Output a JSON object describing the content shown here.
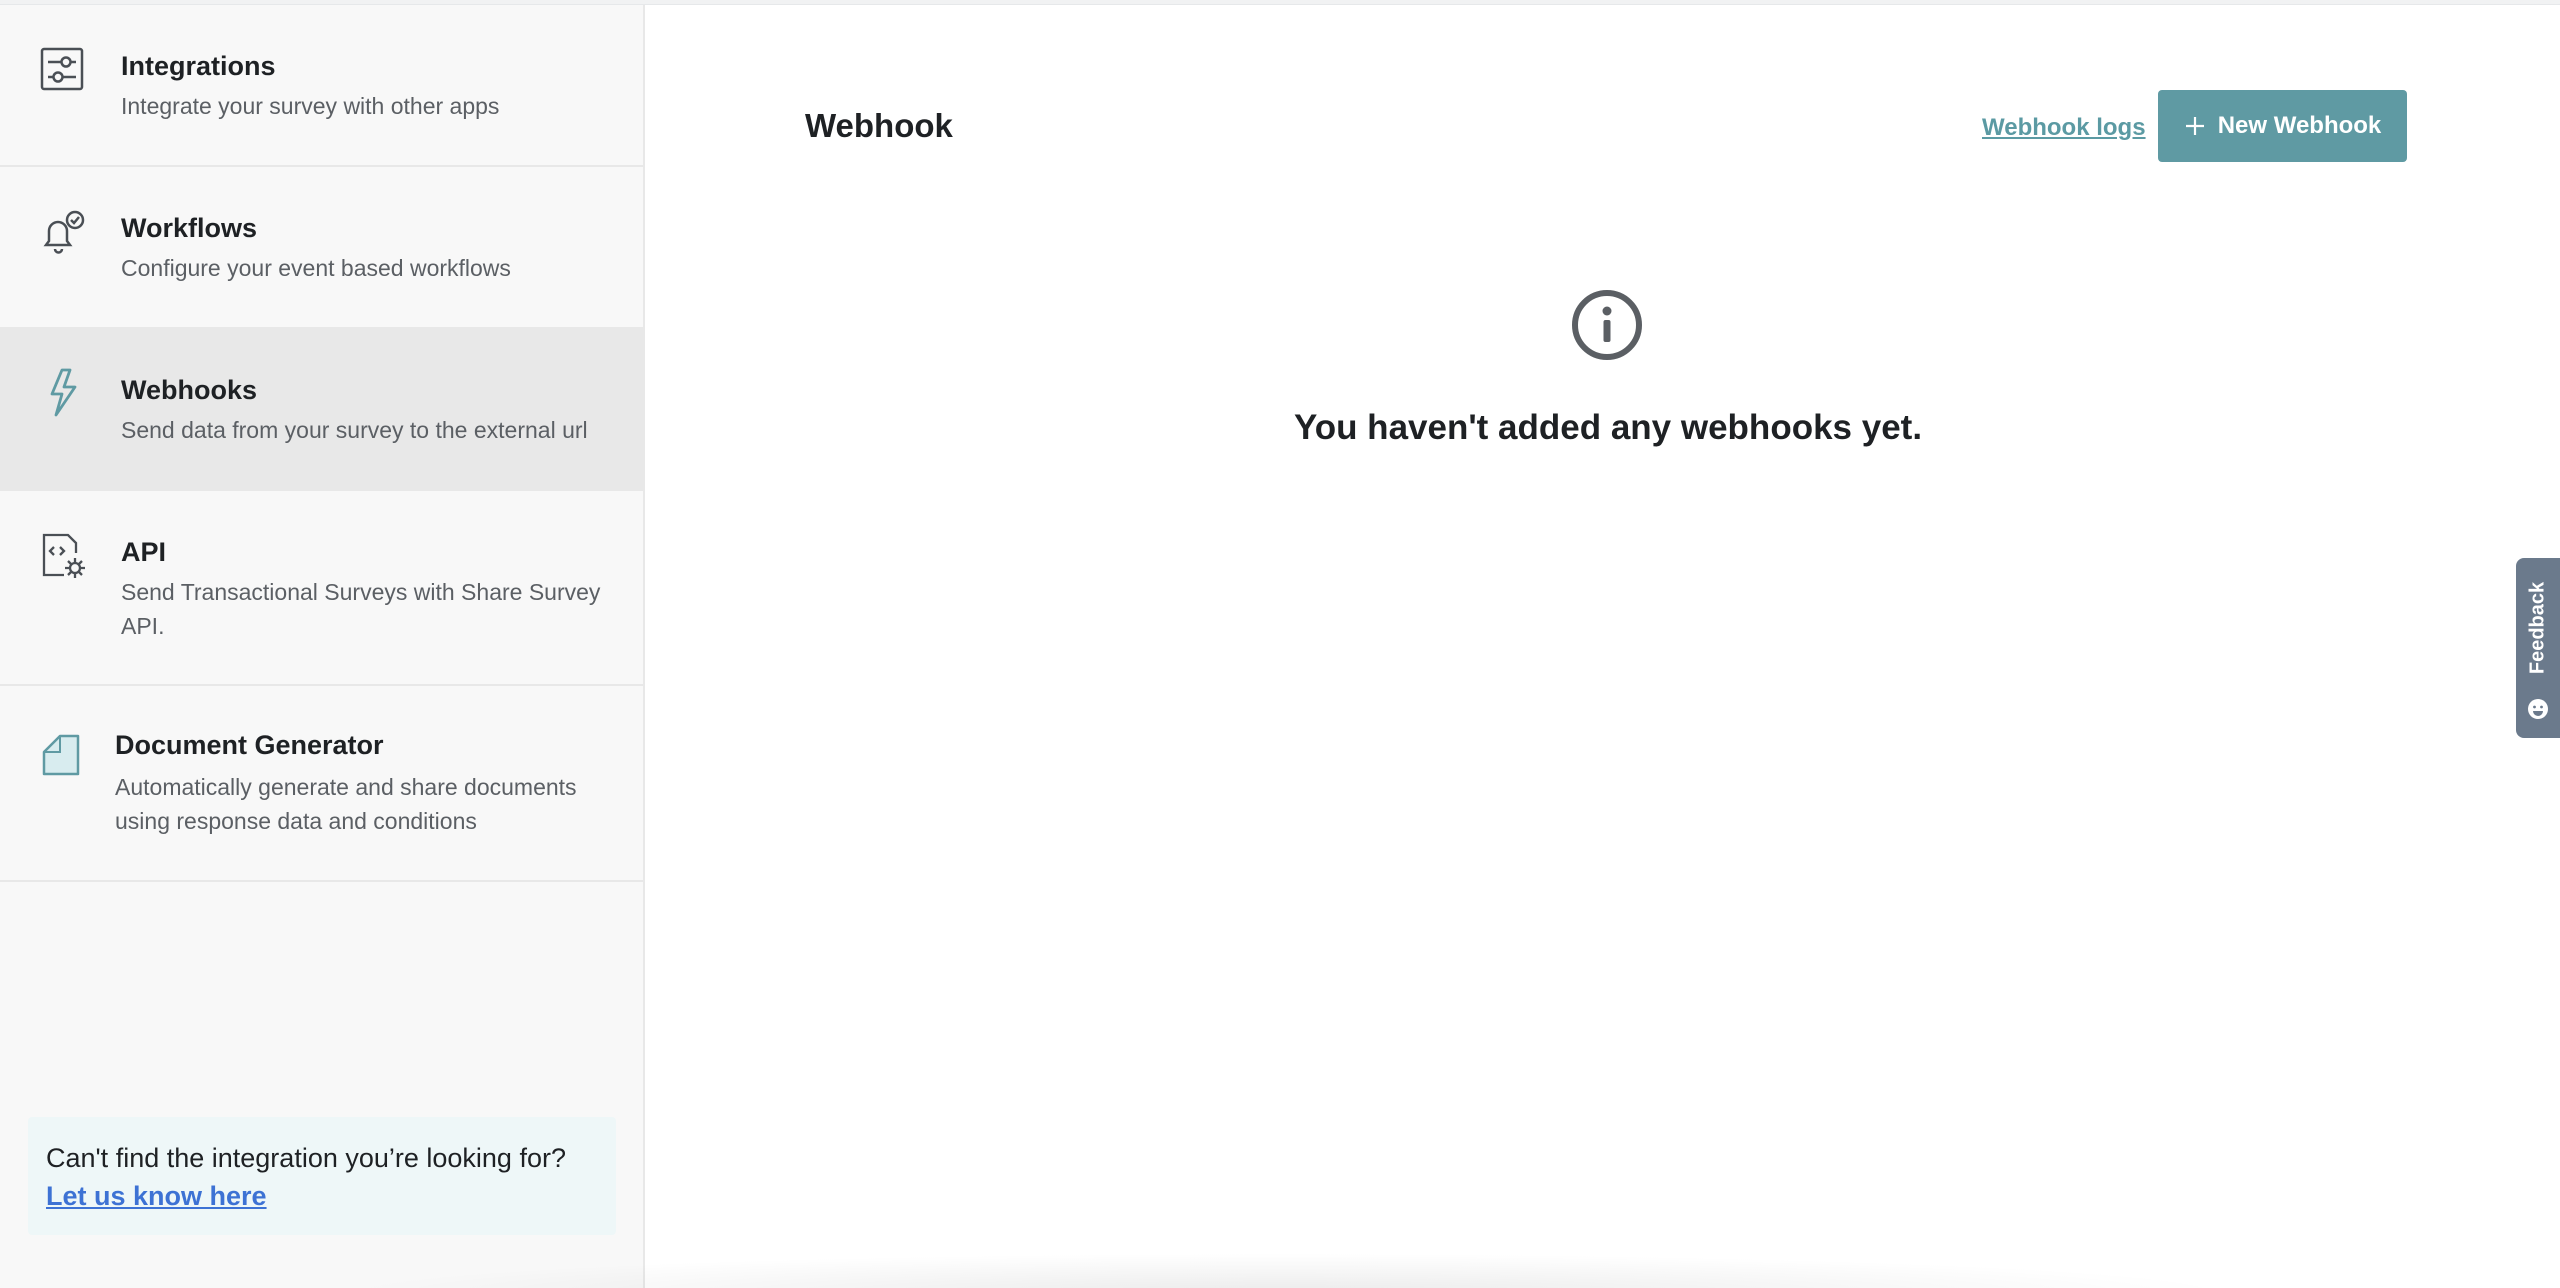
{
  "sidebar": {
    "items": [
      {
        "title": "Integrations",
        "description": "Integrate your survey with other apps",
        "icon": "sliders-icon"
      },
      {
        "title": "Workflows",
        "description": "Configure your event based workflows",
        "icon": "bell-check-icon"
      },
      {
        "title": "Webhooks",
        "description": "Send data from your survey to the external url",
        "icon": "lightning-icon",
        "active": true
      },
      {
        "title": "API",
        "description": "Send Transactional Surveys with Share Survey API.",
        "icon": "code-gear-icon"
      },
      {
        "title": "Document Generator",
        "description": "Automatically generate and share documents using response data and conditions",
        "icon": "document-icon"
      }
    ],
    "help": {
      "text": "Can't find the integration you’re looking for?",
      "link": "Let us know here"
    }
  },
  "main": {
    "title": "Webhook",
    "logs_link": "Webhook logs",
    "new_button": "New Webhook",
    "empty_message": "You haven't added any webhooks yet."
  },
  "feedback": {
    "label": "Feedback"
  },
  "colors": {
    "accent": "#5f9aa3",
    "link": "#3d72d4",
    "active_item": "#e8e8e8",
    "sidebar_bg": "#f8f8f8"
  }
}
